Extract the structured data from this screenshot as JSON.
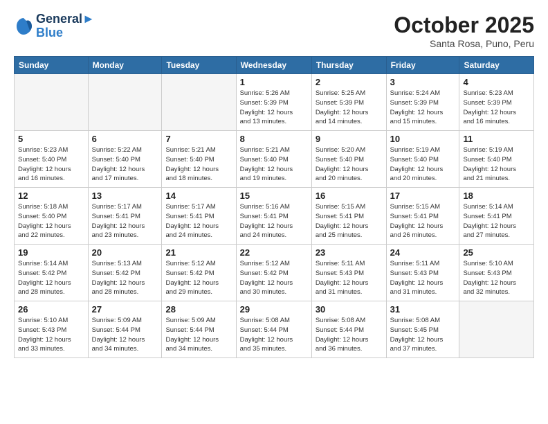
{
  "header": {
    "logo_line1": "General",
    "logo_line2": "Blue",
    "month_title": "October 2025",
    "subtitle": "Santa Rosa, Puno, Peru"
  },
  "weekdays": [
    "Sunday",
    "Monday",
    "Tuesday",
    "Wednesday",
    "Thursday",
    "Friday",
    "Saturday"
  ],
  "weeks": [
    [
      {
        "day": "",
        "info": ""
      },
      {
        "day": "",
        "info": ""
      },
      {
        "day": "",
        "info": ""
      },
      {
        "day": "1",
        "info": "Sunrise: 5:26 AM\nSunset: 5:39 PM\nDaylight: 12 hours\nand 13 minutes."
      },
      {
        "day": "2",
        "info": "Sunrise: 5:25 AM\nSunset: 5:39 PM\nDaylight: 12 hours\nand 14 minutes."
      },
      {
        "day": "3",
        "info": "Sunrise: 5:24 AM\nSunset: 5:39 PM\nDaylight: 12 hours\nand 15 minutes."
      },
      {
        "day": "4",
        "info": "Sunrise: 5:23 AM\nSunset: 5:39 PM\nDaylight: 12 hours\nand 16 minutes."
      }
    ],
    [
      {
        "day": "5",
        "info": "Sunrise: 5:23 AM\nSunset: 5:40 PM\nDaylight: 12 hours\nand 16 minutes."
      },
      {
        "day": "6",
        "info": "Sunrise: 5:22 AM\nSunset: 5:40 PM\nDaylight: 12 hours\nand 17 minutes."
      },
      {
        "day": "7",
        "info": "Sunrise: 5:21 AM\nSunset: 5:40 PM\nDaylight: 12 hours\nand 18 minutes."
      },
      {
        "day": "8",
        "info": "Sunrise: 5:21 AM\nSunset: 5:40 PM\nDaylight: 12 hours\nand 19 minutes."
      },
      {
        "day": "9",
        "info": "Sunrise: 5:20 AM\nSunset: 5:40 PM\nDaylight: 12 hours\nand 20 minutes."
      },
      {
        "day": "10",
        "info": "Sunrise: 5:19 AM\nSunset: 5:40 PM\nDaylight: 12 hours\nand 20 minutes."
      },
      {
        "day": "11",
        "info": "Sunrise: 5:19 AM\nSunset: 5:40 PM\nDaylight: 12 hours\nand 21 minutes."
      }
    ],
    [
      {
        "day": "12",
        "info": "Sunrise: 5:18 AM\nSunset: 5:40 PM\nDaylight: 12 hours\nand 22 minutes."
      },
      {
        "day": "13",
        "info": "Sunrise: 5:17 AM\nSunset: 5:41 PM\nDaylight: 12 hours\nand 23 minutes."
      },
      {
        "day": "14",
        "info": "Sunrise: 5:17 AM\nSunset: 5:41 PM\nDaylight: 12 hours\nand 24 minutes."
      },
      {
        "day": "15",
        "info": "Sunrise: 5:16 AM\nSunset: 5:41 PM\nDaylight: 12 hours\nand 24 minutes."
      },
      {
        "day": "16",
        "info": "Sunrise: 5:15 AM\nSunset: 5:41 PM\nDaylight: 12 hours\nand 25 minutes."
      },
      {
        "day": "17",
        "info": "Sunrise: 5:15 AM\nSunset: 5:41 PM\nDaylight: 12 hours\nand 26 minutes."
      },
      {
        "day": "18",
        "info": "Sunrise: 5:14 AM\nSunset: 5:41 PM\nDaylight: 12 hours\nand 27 minutes."
      }
    ],
    [
      {
        "day": "19",
        "info": "Sunrise: 5:14 AM\nSunset: 5:42 PM\nDaylight: 12 hours\nand 28 minutes."
      },
      {
        "day": "20",
        "info": "Sunrise: 5:13 AM\nSunset: 5:42 PM\nDaylight: 12 hours\nand 28 minutes."
      },
      {
        "day": "21",
        "info": "Sunrise: 5:12 AM\nSunset: 5:42 PM\nDaylight: 12 hours\nand 29 minutes."
      },
      {
        "day": "22",
        "info": "Sunrise: 5:12 AM\nSunset: 5:42 PM\nDaylight: 12 hours\nand 30 minutes."
      },
      {
        "day": "23",
        "info": "Sunrise: 5:11 AM\nSunset: 5:43 PM\nDaylight: 12 hours\nand 31 minutes."
      },
      {
        "day": "24",
        "info": "Sunrise: 5:11 AM\nSunset: 5:43 PM\nDaylight: 12 hours\nand 31 minutes."
      },
      {
        "day": "25",
        "info": "Sunrise: 5:10 AM\nSunset: 5:43 PM\nDaylight: 12 hours\nand 32 minutes."
      }
    ],
    [
      {
        "day": "26",
        "info": "Sunrise: 5:10 AM\nSunset: 5:43 PM\nDaylight: 12 hours\nand 33 minutes."
      },
      {
        "day": "27",
        "info": "Sunrise: 5:09 AM\nSunset: 5:44 PM\nDaylight: 12 hours\nand 34 minutes."
      },
      {
        "day": "28",
        "info": "Sunrise: 5:09 AM\nSunset: 5:44 PM\nDaylight: 12 hours\nand 34 minutes."
      },
      {
        "day": "29",
        "info": "Sunrise: 5:08 AM\nSunset: 5:44 PM\nDaylight: 12 hours\nand 35 minutes."
      },
      {
        "day": "30",
        "info": "Sunrise: 5:08 AM\nSunset: 5:44 PM\nDaylight: 12 hours\nand 36 minutes."
      },
      {
        "day": "31",
        "info": "Sunrise: 5:08 AM\nSunset: 5:45 PM\nDaylight: 12 hours\nand 37 minutes."
      },
      {
        "day": "",
        "info": ""
      }
    ]
  ]
}
